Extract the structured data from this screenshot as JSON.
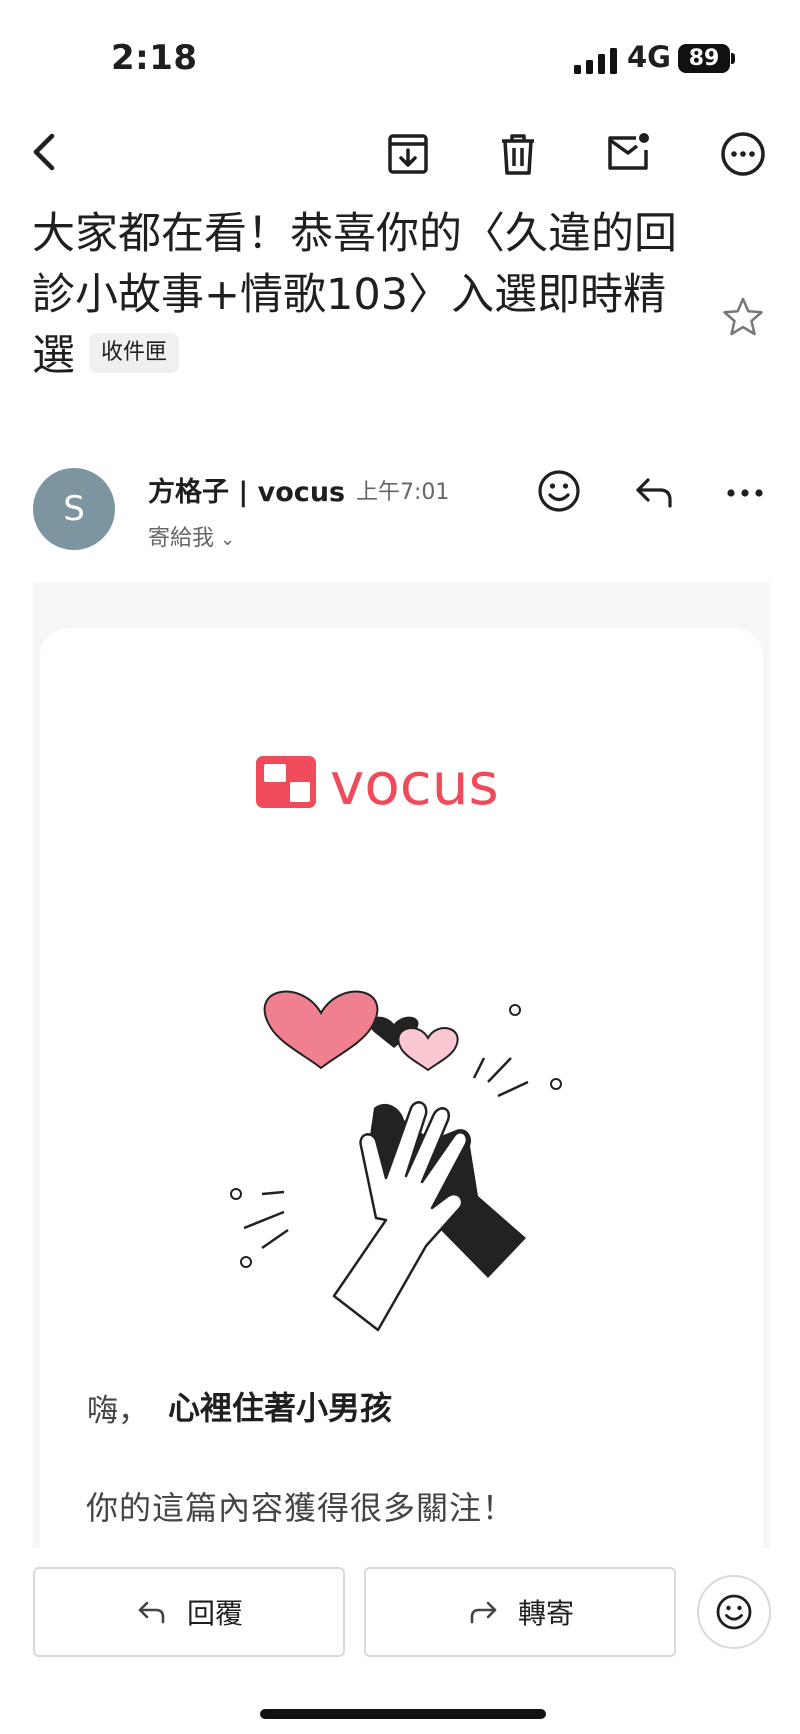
{
  "status_bar": {
    "time": "2:18",
    "network": "4G",
    "battery": "89"
  },
  "toolbar": {
    "back_icon": "chevron-left-icon",
    "archive_icon": "archive-icon",
    "delete_icon": "trash-icon",
    "mark_unread_icon": "mail-unread-icon",
    "more_icon": "more-circle-icon"
  },
  "email": {
    "subject": "大家都在看！恭喜你的〈久違的回診小故事+情歌103〉入選即時精選",
    "label": "收件匣",
    "sender": {
      "avatar_letter": "S",
      "name": "方格子 | vocus",
      "time": "上午7:01",
      "recipient": "寄給我"
    },
    "body": {
      "logo_text": "vocus",
      "greeting": "嗨，",
      "name": "心裡住著小男孩",
      "message": "你的這篇內容獲得很多關注！"
    }
  },
  "actions": {
    "reply": "回覆",
    "forward": "轉寄"
  },
  "colors": {
    "brand": "#f04b5b",
    "avatar": "#7d95a1"
  }
}
